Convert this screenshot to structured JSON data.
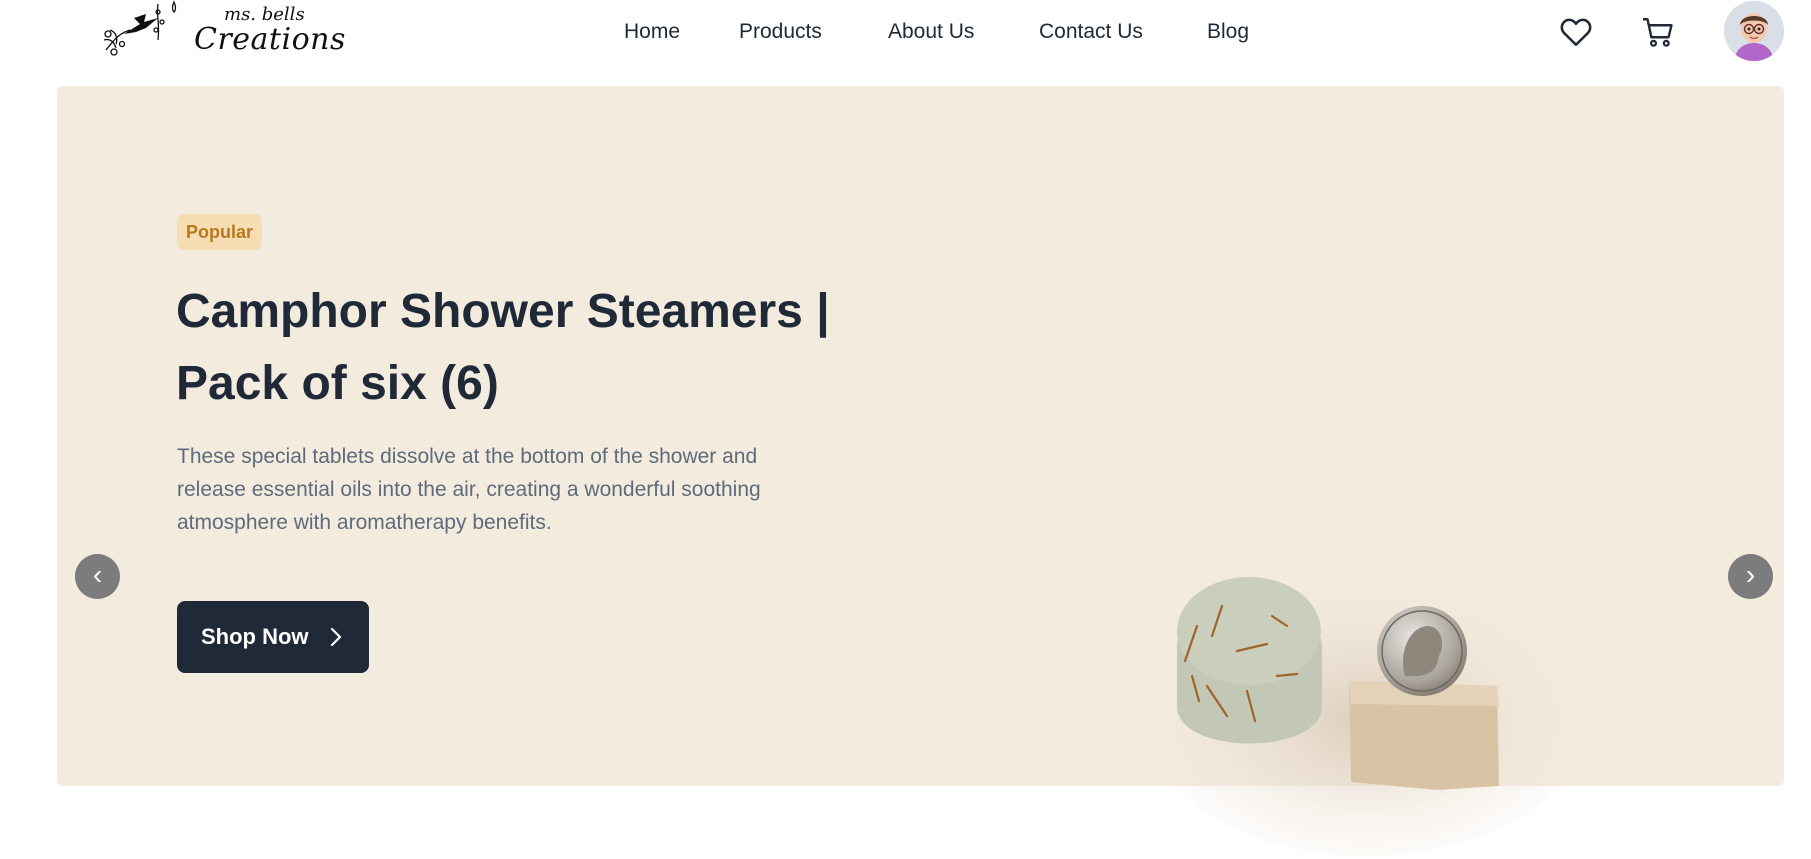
{
  "brand": {
    "logo_small": "ms. bells",
    "logo_big": "Creations"
  },
  "nav": {
    "items": [
      {
        "label": "Home"
      },
      {
        "label": "Products"
      },
      {
        "label": "About Us"
      },
      {
        "label": "Contact Us"
      },
      {
        "label": "Blog"
      }
    ]
  },
  "header_icons": {
    "wishlist": "heart-icon",
    "cart": "cart-icon",
    "profile": "avatar"
  },
  "hero": {
    "badge": "Popular",
    "title": "Camphor Shower Steamers | Pack of six (6)",
    "description": "These special tablets dissolve at the bottom of the shower and release essential oils into the air, creating a wonderful soothing atmosphere with aromatherapy benefits.",
    "cta_label": "Shop Now",
    "prev_glyph": "‹",
    "next_glyph": "›"
  },
  "colors": {
    "hero_bg": "#f4ebdf",
    "badge_bg": "#f7ddb3",
    "badge_text": "#b7791f",
    "button_bg": "#1f2937",
    "carousel_arrow": "#7c7c7c"
  }
}
